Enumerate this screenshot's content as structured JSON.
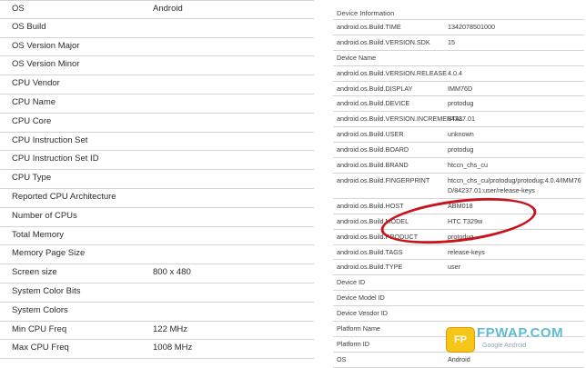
{
  "left_table": {
    "rows": [
      {
        "label": "OS",
        "value": "Android"
      },
      {
        "label": "OS Build",
        "value": ""
      },
      {
        "label": "OS Version Major",
        "value": ""
      },
      {
        "label": "OS Version Minor",
        "value": ""
      },
      {
        "label": "CPU Vendor",
        "value": ""
      },
      {
        "label": "CPU Name",
        "value": ""
      },
      {
        "label": "CPU Core",
        "value": ""
      },
      {
        "label": "CPU Instruction Set",
        "value": ""
      },
      {
        "label": "CPU Instruction Set ID",
        "value": ""
      },
      {
        "label": "CPU Type",
        "value": ""
      },
      {
        "label": "Reported CPU Architecture",
        "value": ""
      },
      {
        "label": "Number of CPUs",
        "value": ""
      },
      {
        "label": "Total Memory",
        "value": ""
      },
      {
        "label": "Memory Page Size",
        "value": ""
      },
      {
        "label": "Screen size",
        "value": "800 x 480"
      },
      {
        "label": "System Color Bits",
        "value": ""
      },
      {
        "label": "System Colors",
        "value": ""
      },
      {
        "label": "Min CPU Freq",
        "value": "122 MHz"
      },
      {
        "label": "Max CPU Freq",
        "value": "1008 MHz"
      }
    ]
  },
  "right_table": {
    "header": "Device Information",
    "rows": [
      {
        "label": "android.os.Build.TIME",
        "value": "1342078501000"
      },
      {
        "label": "android.os.Build.VERSION.SDK",
        "value": "15"
      },
      {
        "label": "Device Name",
        "value": ""
      },
      {
        "label": "android.os.Build.VERSION.RELEASE",
        "value": "4.0.4"
      },
      {
        "label": "android.os.Build.DISPLAY",
        "value": "IMM76D"
      },
      {
        "label": "android.os.Build.DEVICE",
        "value": "protodug"
      },
      {
        "label": "android.os.Build.VERSION.INCREMENTAL",
        "value": "84237.01"
      },
      {
        "label": "android.os.Build.USER",
        "value": "unknown"
      },
      {
        "label": "android.os.Build.BOARD",
        "value": "protodug"
      },
      {
        "label": "android.os.Build.BRAND",
        "value": "htccn_chs_cu"
      },
      {
        "label": "android.os.Build.FINGERPRINT",
        "value": "htccn_chs_cu/protodug/protodug:4.0.4/IMM76",
        "value2": "D/84237.01:user/release-keys"
      },
      {
        "label": "android.os.Build.HOST",
        "value": "ABM018"
      },
      {
        "label": "android.os.Build.MODEL",
        "value": "HTC T329w"
      },
      {
        "label": "android.os.Build.PRODUCT",
        "value": "protodug"
      },
      {
        "label": "android.os.Build.TAGS",
        "value": "release-keys"
      },
      {
        "label": "android.os.Build.TYPE",
        "value": "user"
      },
      {
        "label": "Device ID",
        "value": ""
      },
      {
        "label": "Device Model ID",
        "value": ""
      },
      {
        "label": "Device Vendor ID",
        "value": ""
      },
      {
        "label": "Platform Name",
        "value": ""
      },
      {
        "label": "Platform ID",
        "value": ""
      },
      {
        "label": "OS",
        "value": "Android"
      }
    ]
  },
  "watermark": {
    "logo_text": "FP",
    "title": "FPWAP.COM",
    "subtitle": "Google Android"
  },
  "colors": {
    "highlight": "#c8141c",
    "watermark_blue": "#5fbcd3",
    "watermark_logo": "#f5c518"
  }
}
